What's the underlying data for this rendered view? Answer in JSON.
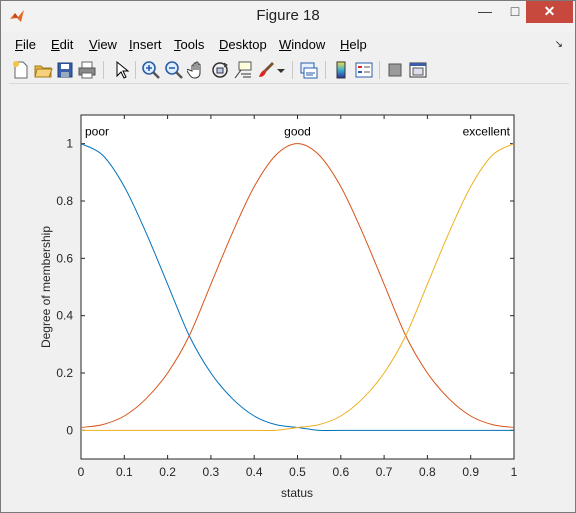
{
  "window": {
    "title": "Figure 18"
  },
  "menubar": {
    "items": [
      {
        "key": "F",
        "rest": "ile"
      },
      {
        "key": "E",
        "rest": "dit"
      },
      {
        "key": "V",
        "rest": "iew"
      },
      {
        "key": "I",
        "rest": "nsert"
      },
      {
        "key": "T",
        "rest": "ools"
      },
      {
        "key": "D",
        "rest": "esktop"
      },
      {
        "key": "W",
        "rest": "indow"
      },
      {
        "key": "H",
        "rest": "elp"
      }
    ]
  },
  "toolbar": {
    "icons": [
      "new-figure-icon",
      "open-file-icon",
      "save-icon",
      "print-icon",
      "edit-plot-arrow-icon",
      "zoom-in-icon",
      "zoom-out-icon",
      "pan-hand-icon",
      "rotate-3d-icon",
      "data-cursor-icon",
      "brush-icon",
      "brush-dropdown-icon",
      "link-plot-icon",
      "insert-colorbar-icon",
      "insert-legend-icon",
      "hide-plot-tools-icon",
      "show-plot-tools-icon"
    ]
  },
  "colors": {
    "poor": "#0072bd",
    "good": "#d95319",
    "excellent": "#edb120"
  },
  "chart_data": {
    "type": "line",
    "xlabel": "status",
    "ylabel": "Degree of membership",
    "xlim": [
      0,
      1
    ],
    "ylim": [
      -0.1,
      1.1
    ],
    "xticks": [
      "0",
      "0.1",
      "0.2",
      "0.3",
      "0.4",
      "0.5",
      "0.6",
      "0.7",
      "0.8",
      "0.9",
      "1"
    ],
    "yticks": [
      "0",
      "0.2",
      "0.4",
      "0.6",
      "0.8",
      "1"
    ],
    "series": [
      {
        "name": "poor",
        "x": [
          0,
          0.05,
          0.1,
          0.15,
          0.2,
          0.25,
          0.3,
          0.35,
          0.4,
          0.45,
          0.5,
          0.55,
          0.6,
          0.7,
          0.8,
          0.9,
          1
        ],
        "values": [
          1,
          0.96,
          0.85,
          0.69,
          0.51,
          0.33,
          0.2,
          0.11,
          0.05,
          0.02,
          0.01,
          0,
          0,
          0,
          0,
          0,
          0
        ]
      },
      {
        "name": "good",
        "x": [
          0,
          0.05,
          0.1,
          0.15,
          0.2,
          0.25,
          0.3,
          0.35,
          0.4,
          0.45,
          0.5,
          0.55,
          0.6,
          0.65,
          0.7,
          0.75,
          0.8,
          0.85,
          0.9,
          0.95,
          1
        ],
        "values": [
          0.01,
          0.02,
          0.05,
          0.11,
          0.2,
          0.33,
          0.51,
          0.69,
          0.85,
          0.96,
          1,
          0.96,
          0.85,
          0.69,
          0.51,
          0.33,
          0.2,
          0.11,
          0.05,
          0.02,
          0.01
        ]
      },
      {
        "name": "excellent",
        "x": [
          0,
          0.1,
          0.2,
          0.3,
          0.4,
          0.45,
          0.5,
          0.55,
          0.6,
          0.65,
          0.7,
          0.75,
          0.8,
          0.85,
          0.9,
          0.95,
          1
        ],
        "values": [
          0,
          0,
          0,
          0,
          0,
          0,
          0.01,
          0.02,
          0.05,
          0.11,
          0.2,
          0.33,
          0.51,
          0.69,
          0.85,
          0.96,
          1
        ]
      }
    ]
  }
}
